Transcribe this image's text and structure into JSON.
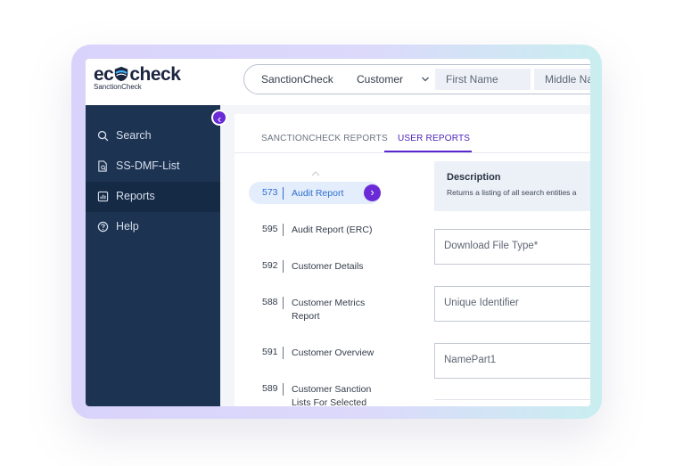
{
  "app": {
    "logo_main_left": "ec",
    "logo_main_right": "check",
    "logo_sub": "SanctionCheck"
  },
  "sidebar": {
    "collapse_icon": "chevron-left-icon",
    "items": [
      {
        "label": "Search",
        "icon": "search-icon",
        "active": false
      },
      {
        "label": "SS-DMF-List",
        "icon": "document-search-icon",
        "active": false
      },
      {
        "label": "Reports",
        "icon": "report-icon",
        "active": true
      },
      {
        "label": "Help",
        "icon": "help-icon",
        "active": false
      }
    ]
  },
  "topbar": {
    "source": "SanctionCheck",
    "entity_type": "Customer",
    "first_name_placeholder": "First Name",
    "middle_name_placeholder": "Middle Na"
  },
  "tabs": [
    {
      "label": "SANCTIONCHECK REPORTS",
      "active": false
    },
    {
      "label": "USER REPORTS",
      "active": true
    }
  ],
  "reports": [
    {
      "id": "573",
      "name": "Audit Report",
      "active": true
    },
    {
      "id": "595",
      "name": "Audit Report (ERC)",
      "active": false
    },
    {
      "id": "592",
      "name": "Customer Details",
      "active": false
    },
    {
      "id": "588",
      "name": "Customer Metrics Report",
      "active": false
    },
    {
      "id": "591",
      "name": "Customer Overview",
      "active": false
    },
    {
      "id": "589",
      "name": "Customer Sanction Lists For Selected",
      "active": false
    }
  ],
  "description": {
    "title": "Description",
    "text": "Returns a listing of all search entities a"
  },
  "form": {
    "download_file_type_placeholder": "Download File Type*",
    "unique_identifier_placeholder": "Unique Identifier",
    "name_part1_placeholder": "NamePart1"
  },
  "colors": {
    "sidebar_bg": "#1c3352",
    "accent": "#6a2bd6",
    "active_tab": "#4a1fb8",
    "active_report_bg": "#e3edfb"
  }
}
